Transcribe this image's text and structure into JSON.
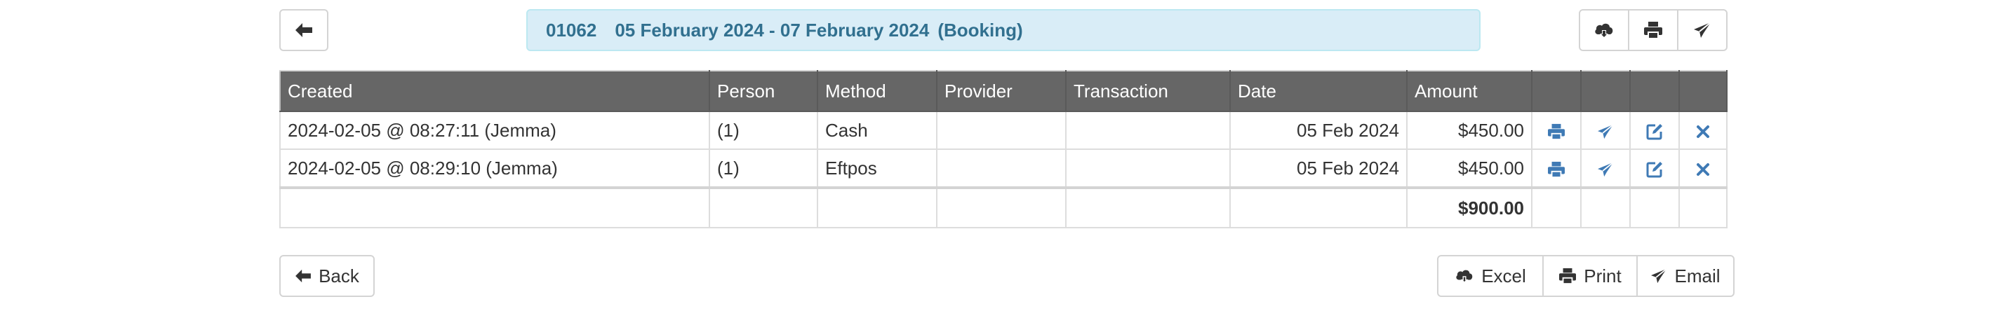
{
  "header": {
    "booking_number": "01062",
    "date_range": "05 February 2024 - 07 February 2024",
    "type": "(Booking)"
  },
  "table": {
    "columns": [
      "Created",
      "Person",
      "Method",
      "Provider",
      "Transaction",
      "Date",
      "Amount"
    ],
    "rows": [
      {
        "created": "2024-02-05 @ 08:27:11 (Jemma)",
        "person": "(1)",
        "method": "Cash",
        "provider": "",
        "transaction": "",
        "date": "05 Feb 2024",
        "amount": "$450.00"
      },
      {
        "created": "2024-02-05 @ 08:29:10 (Jemma)",
        "person": "(1)",
        "method": "Eftpos",
        "provider": "",
        "transaction": "",
        "date": "05 Feb 2024",
        "amount": "$450.00"
      }
    ],
    "total": "$900.00"
  },
  "footer": {
    "back_label": "Back",
    "excel_label": "Excel",
    "print_label": "Print",
    "email_label": "Email"
  },
  "icons": {
    "back": "arrow-left-icon",
    "download": "cloud-download-icon",
    "print": "printer-icon",
    "send": "paper-plane-icon",
    "edit": "edit-icon",
    "delete": "close-icon"
  },
  "colors": {
    "banner_bg": "#d9edf7",
    "banner_text": "#31708f",
    "header_bg": "#666666",
    "icon_blue": "#3f7ab5"
  }
}
